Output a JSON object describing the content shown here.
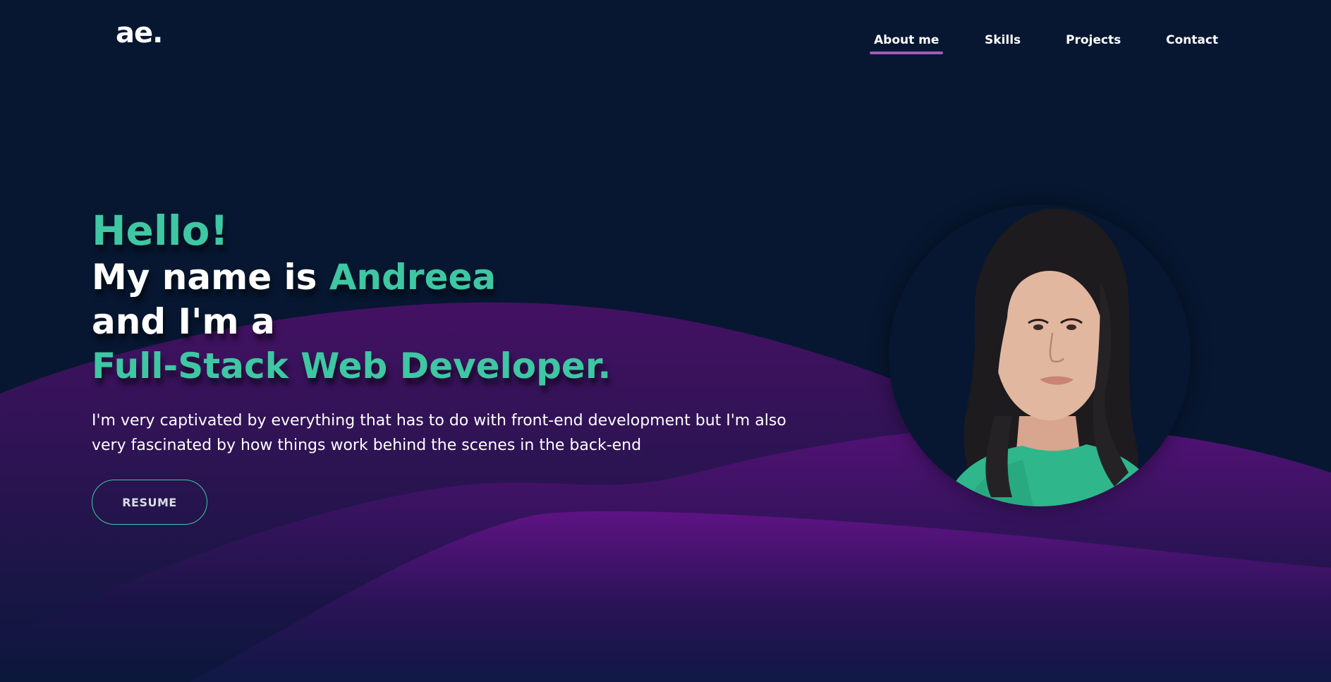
{
  "logo": {
    "text": "ae."
  },
  "nav": {
    "items": [
      {
        "label": "About me",
        "active": true
      },
      {
        "label": "Skills",
        "active": false
      },
      {
        "label": "Projects",
        "active": false
      },
      {
        "label": "Contact",
        "active": false
      }
    ]
  },
  "hero": {
    "greeting": "Hello!",
    "name_prefix": "My name is",
    "name": "Andreea",
    "role_prefix": "and I'm a",
    "role": "Full-Stack Web Developer.",
    "description": "I'm very captivated by everything that has to do with front-end development but I'm also very fascinated by how things work behind the scenes in the back-end",
    "resume_label": "RESUME"
  },
  "colors": {
    "background": "#071731",
    "accent": "#3ec7a3",
    "nav_underline": "#a15bb6",
    "wave": "#5d1282"
  }
}
